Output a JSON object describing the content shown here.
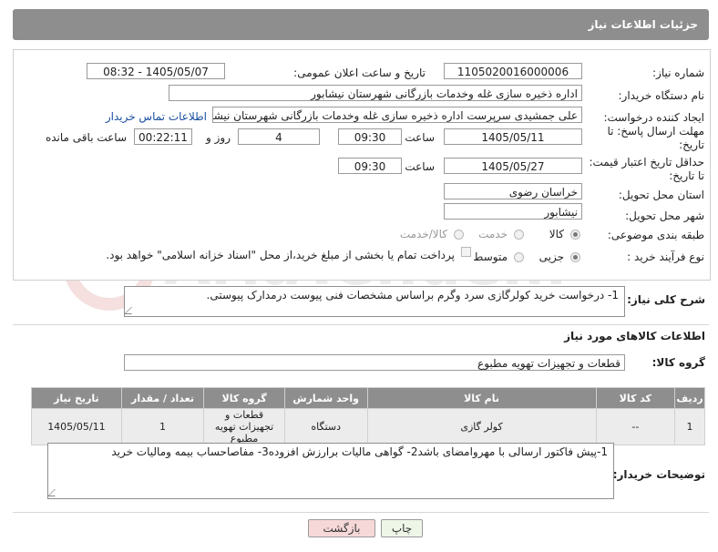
{
  "header": {
    "title": "جزئیات اطلاعات نیاز"
  },
  "fields": {
    "need_number_label": "شماره نیاز:",
    "need_number": "1105020016000006",
    "announce_label": "تاریخ و ساعت اعلان عمومی:",
    "announce_value": "1405/05/07 - 08:32",
    "buyer_org_label": "نام دستگاه خریدار:",
    "buyer_org": "اداره ذخیره سازی غله وخدمات بازرگانی شهرستان نیشابور",
    "creator_label": "ایجاد کننده درخواست:",
    "creator": "علی جمشیدی سرپرست اداره ذخیره سازی غله وخدمات بازرگانی شهرستان نیشابور",
    "contact_link": "اطلاعات تماس خریدار",
    "deadline_label_1": "مهلت ارسال پاسخ: تا",
    "deadline_label_2": "تاریخ:",
    "deadline_date": "1405/05/11",
    "time_label": "ساعت",
    "deadline_time": "09:30",
    "days_value": "4",
    "days_label": "روز و",
    "remaining_time": "00:22:11",
    "remaining_label": "ساعت باقی مانده",
    "price_label_1": "حداقل تاریخ اعتبار قیمت:",
    "price_label_2": "تا تاریخ:",
    "price_date": "1405/05/27",
    "price_time": "09:30",
    "province_label": "استان محل تحویل:",
    "province": "خراسان رضوی",
    "city_label": "شهر محل تحویل:",
    "city": "نیشابور",
    "category_label": "طبقه بندی موضوعی:",
    "category_options": [
      "کالا",
      "خدمت",
      "کالا/خدمت"
    ],
    "process_label": "نوع فرآیند خرید :",
    "process_options": [
      "جزیی",
      "متوسط"
    ],
    "payment_note": "پرداخت تمام یا بخشی از مبلغ خرید،از محل \"اسناد خزانه اسلامی\" خواهد بود."
  },
  "description": {
    "label": "شرح کلی نیاز:",
    "text": "1- درخواست خرید کولرگازی سرد وگرم براساس مشخصات فنی پیوست درمدارک پیوستی."
  },
  "goods": {
    "section_title": "اطلاعات کالاهای مورد نیاز",
    "group_label": "گروه کالا:",
    "group_value": "قطعات و تجهیزات تهویه مطبوع",
    "columns": [
      "ردیف",
      "کد کالا",
      "نام کالا",
      "واحد شمارش",
      "گروه کالا",
      "تعداد / مقدار",
      "تاریخ نیاز"
    ],
    "rows": [
      [
        "1",
        "--",
        "کولر گازی",
        "دستگاه",
        "قطعات و تجهیزات تهویه مطبوع",
        "1",
        "1405/05/11"
      ]
    ]
  },
  "buyer_notes": {
    "label": "توضیحات خریدار:",
    "text": "1-پیش فاکتور ارسالی با مهروامضای باشد2- گواهی مالیات برارزش افزوده3- مفاصاحساب بیمه ومالیات خرید"
  },
  "buttons": {
    "print": "چاپ",
    "back": "بازگشت"
  },
  "watermark": "AriaTender.net",
  "colors": {
    "header_bg": "#8e8e8e",
    "row_bg": "#ececec",
    "back_btn_bg": "#f6d8d8",
    "print_btn_bg": "#e8f4e0"
  }
}
